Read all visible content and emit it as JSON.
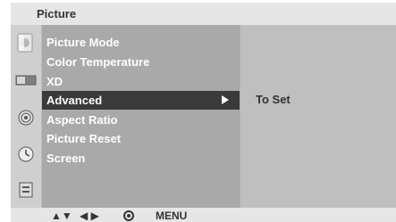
{
  "header": {
    "title": "Picture"
  },
  "icons": [
    {
      "name": "picture-icon",
      "selected": true
    },
    {
      "name": "screen-icon"
    },
    {
      "name": "option-icon"
    },
    {
      "name": "time-icon"
    },
    {
      "name": "lock-icon"
    }
  ],
  "menu": {
    "items": [
      {
        "label": "Picture Mode"
      },
      {
        "label": "Color Temperature"
      },
      {
        "label": "XD"
      },
      {
        "label": "Advanced"
      },
      {
        "label": "Aspect Ratio"
      },
      {
        "label": "Picture Reset"
      },
      {
        "label": "Screen"
      }
    ],
    "selected_index": 3
  },
  "submenu": {
    "text": "To Set"
  },
  "footer": {
    "updown": "▲▼",
    "leftright": "◀ ▶",
    "ok_icon": "ok-button-icon",
    "menu_label": "MENU"
  },
  "colors": {
    "menu_bg": "#a9a9a9",
    "selected_bg": "#3a3a3a",
    "submenu_bg": "#bfbfbf",
    "bar_bg": "#e6e6e6"
  }
}
